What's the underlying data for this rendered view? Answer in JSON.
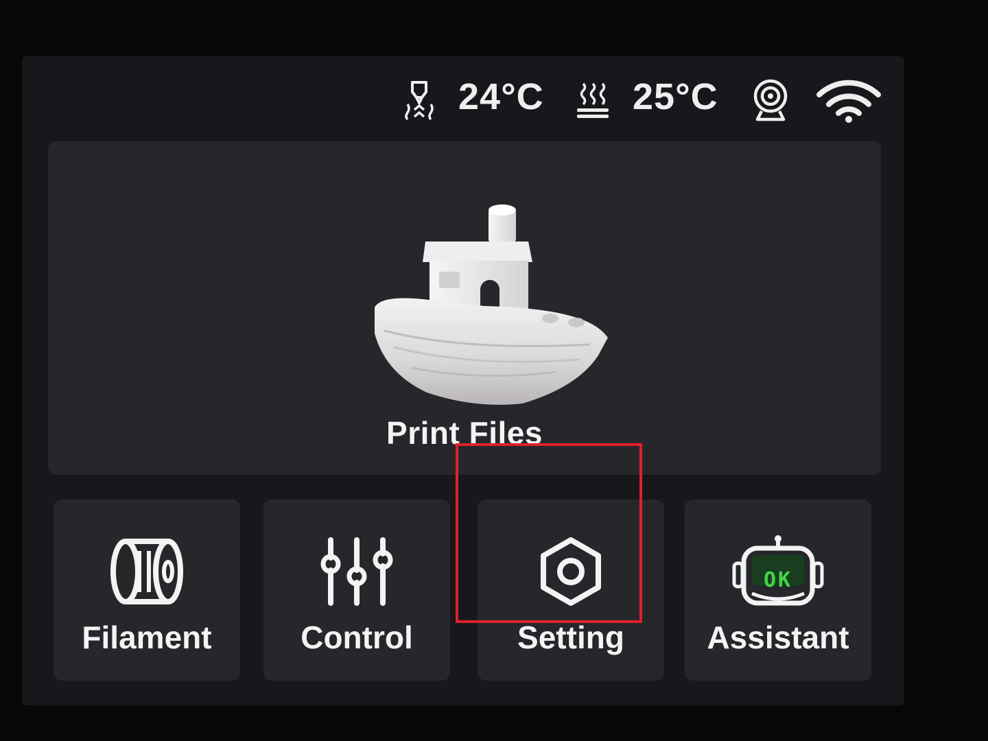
{
  "status_bar": {
    "nozzle_icon": "nozzle-heater-icon",
    "nozzle_temp": "24°C",
    "bed_icon": "heated-bed-icon",
    "bed_temp": "25°C",
    "camera_icon": "camera-icon",
    "wifi_icon": "wifi-icon"
  },
  "main": {
    "print_files_label": "Print Files",
    "print_files_icon": "benchy-boat-model"
  },
  "tiles": [
    {
      "label": "Filament",
      "icon": "filament-spool-icon"
    },
    {
      "label": "Control",
      "icon": "sliders-icon"
    },
    {
      "label": "Setting",
      "icon": "hex-nut-settings-icon"
    },
    {
      "label": "Assistant",
      "icon": "robot-assistant-icon"
    }
  ],
  "assistant_badge": "OK",
  "colors": {
    "background": "#070707",
    "screen": "#17181b",
    "card": "#26272a",
    "text": "#f3f3f3",
    "highlight": "#e0202a",
    "ok_green": "#3fd64a"
  }
}
